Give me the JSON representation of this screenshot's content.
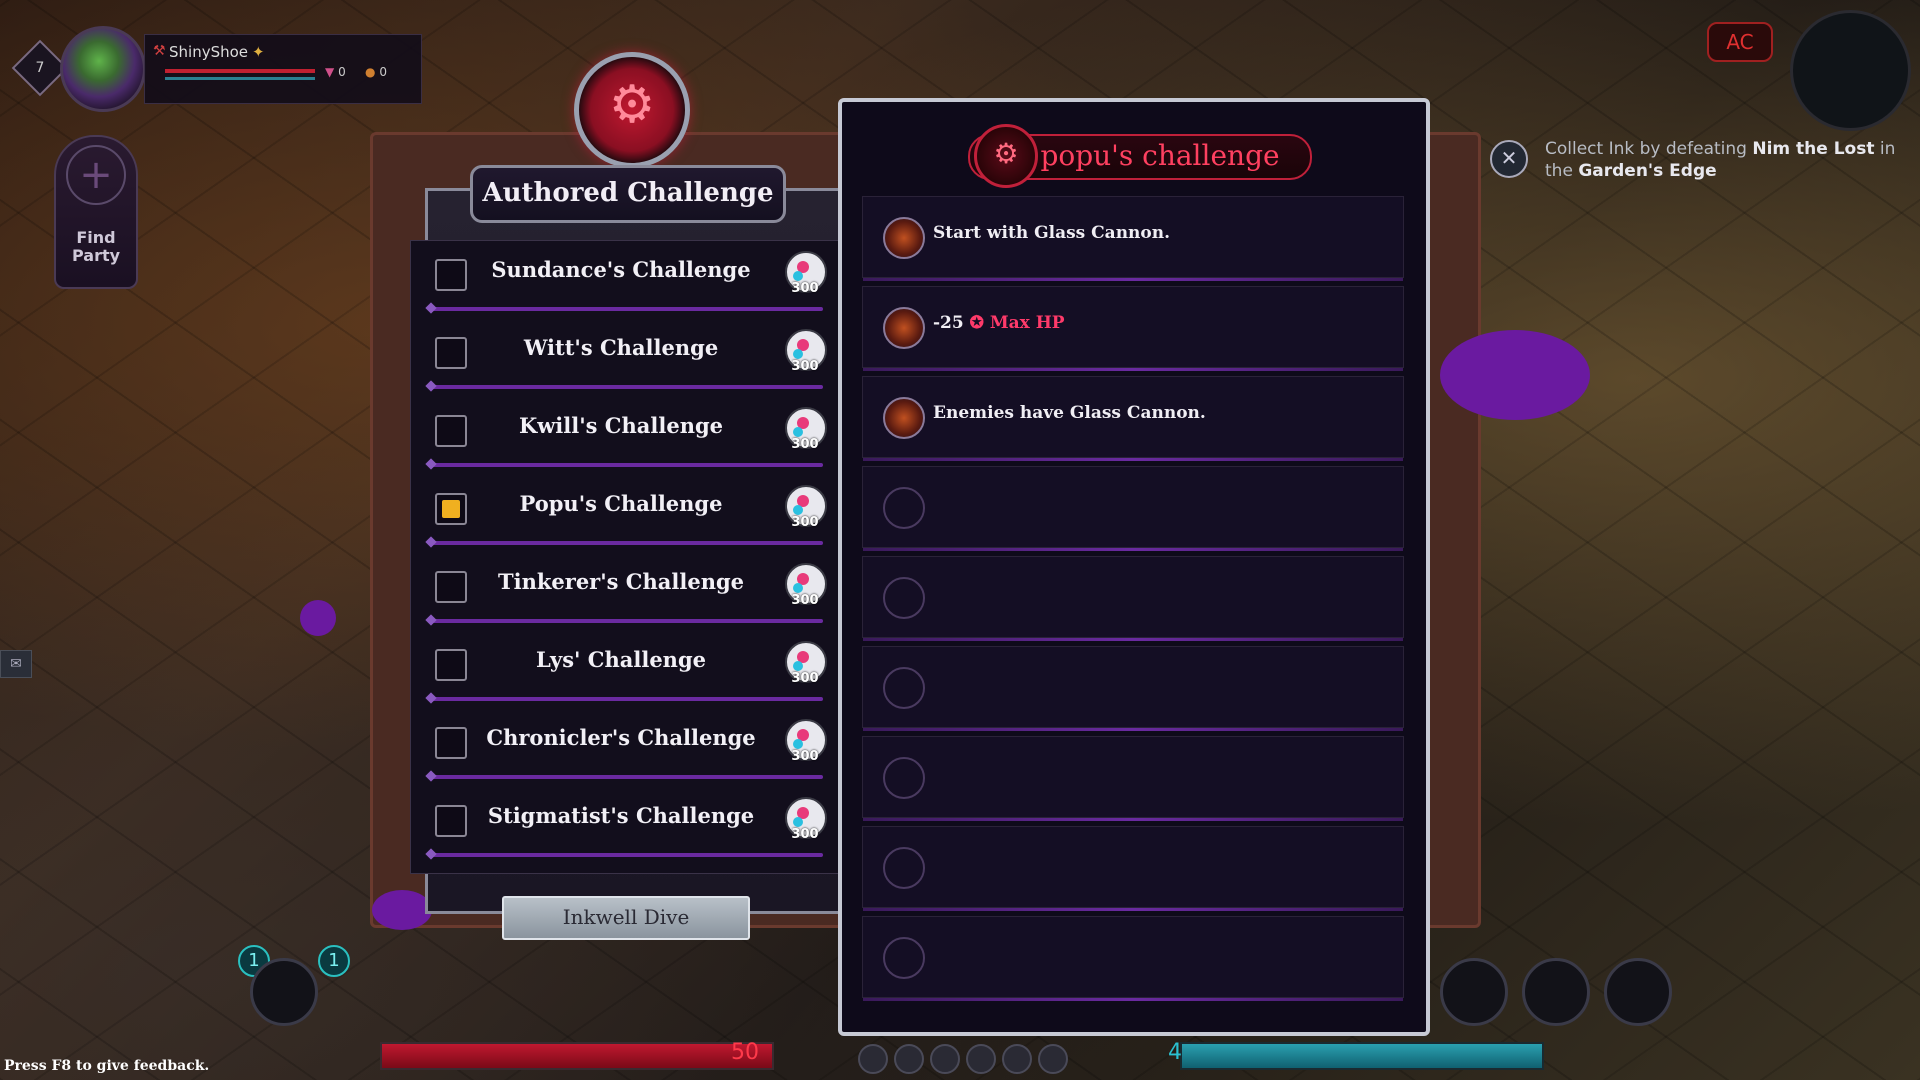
{
  "player": {
    "level": "7",
    "name": "ShinyShoe",
    "stat_gems": "0",
    "stat_coins": "0",
    "find_party_label_1": "Find",
    "find_party_label_2": "Party"
  },
  "top_right": {
    "badge": "AC"
  },
  "quest": {
    "text_1": "Collect Ink by defeating ",
    "target": "Nim the Lost",
    "text_2": " in the ",
    "location": "Garden's Edge"
  },
  "challenge_list": {
    "title": "Authored Challenge",
    "items": [
      {
        "label": "Sundance's Challenge",
        "reward": "300",
        "checked": false
      },
      {
        "label": "Witt's Challenge",
        "reward": "300",
        "checked": false
      },
      {
        "label": "Kwill's Challenge",
        "reward": "300",
        "checked": false
      },
      {
        "label": "Popu's Challenge",
        "reward": "300",
        "checked": true
      },
      {
        "label": "Tinkerer's Challenge",
        "reward": "300",
        "checked": false
      },
      {
        "label": "Lys' Challenge",
        "reward": "300",
        "checked": false
      },
      {
        "label": "Chronicler's Challenge",
        "reward": "300",
        "checked": false
      },
      {
        "label": "Stigmatist's Challenge",
        "reward": "300",
        "checked": false
      }
    ],
    "button": "Inkwell Dive"
  },
  "detail": {
    "title": "popu's challenge",
    "mods": [
      {
        "text": "Start with Glass Cannon."
      },
      {
        "text_prefix": "-25 ",
        "text_highlight": "Max HP"
      },
      {
        "text": "Enemies have Glass Cannon."
      }
    ]
  },
  "hud": {
    "hp": "50",
    "mana": "4",
    "skill_badge_1": "1",
    "skill_badge_2": "1"
  },
  "footer": {
    "feedback": "Press F8 to give feedback."
  },
  "colors": {
    "accent_purple": "#6a2aa0",
    "accent_red": "#c0203a",
    "checked_yellow": "#f0b020"
  }
}
